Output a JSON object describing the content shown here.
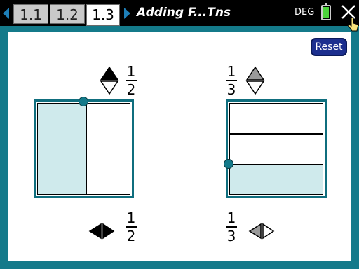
{
  "tabs": [
    {
      "label": "1.1"
    },
    {
      "label": "1.2"
    },
    {
      "label": "1.3"
    }
  ],
  "active_tab": "1.3",
  "document_title": "Adding F...Tns",
  "angle_mode": "DEG",
  "reset_label": "Reset",
  "left_model": {
    "top_fraction": {
      "numerator": "1",
      "denominator": "2"
    },
    "bottom_fraction": {
      "numerator": "1",
      "denominator": "2"
    },
    "partitions": 2,
    "shaded": 1
  },
  "right_model": {
    "top_fraction": {
      "numerator": "1",
      "denominator": "3"
    },
    "bottom_fraction": {
      "numerator": "1",
      "denominator": "3"
    },
    "partitions": 3,
    "shaded": 1
  },
  "icons": {
    "tabs_left": "triangle-left-icon",
    "tabs_right": "triangle-right-icon",
    "battery": "battery-icon",
    "close": "close-icon",
    "stepper": "up-down-stepper-icon",
    "hstepper": "left-right-stepper-icon",
    "handle": "drag-handle-icon"
  },
  "colors": {
    "page_bg": "#147a8a",
    "shade": "#cfeaec",
    "reset_button": "#1c2f8f",
    "tab_arrow": "#1e7fb8",
    "battery": "#4cd23b"
  }
}
